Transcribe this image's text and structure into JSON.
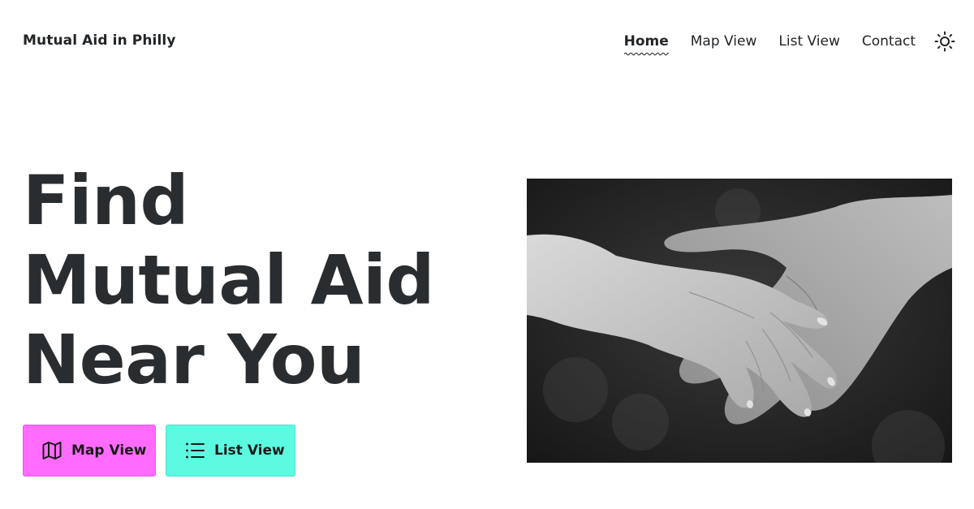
{
  "header": {
    "site_title": "Mutual Aid in Philly",
    "nav": [
      {
        "label": "Home",
        "active": true
      },
      {
        "label": "Map View",
        "active": false
      },
      {
        "label": "List View",
        "active": false
      },
      {
        "label": "Contact",
        "active": false
      }
    ],
    "theme_toggle_icon": "sun-icon"
  },
  "hero": {
    "title_lines": [
      "Find",
      "Mutual Aid",
      "Near You"
    ],
    "buttons": [
      {
        "label": "Map View",
        "icon": "map-icon",
        "color": "#fe6bfd"
      },
      {
        "label": "List View",
        "icon": "list-icon",
        "color": "#5cfbe1"
      }
    ],
    "image": {
      "icon": "holding-hands-photo",
      "style": "black-and-white"
    }
  }
}
